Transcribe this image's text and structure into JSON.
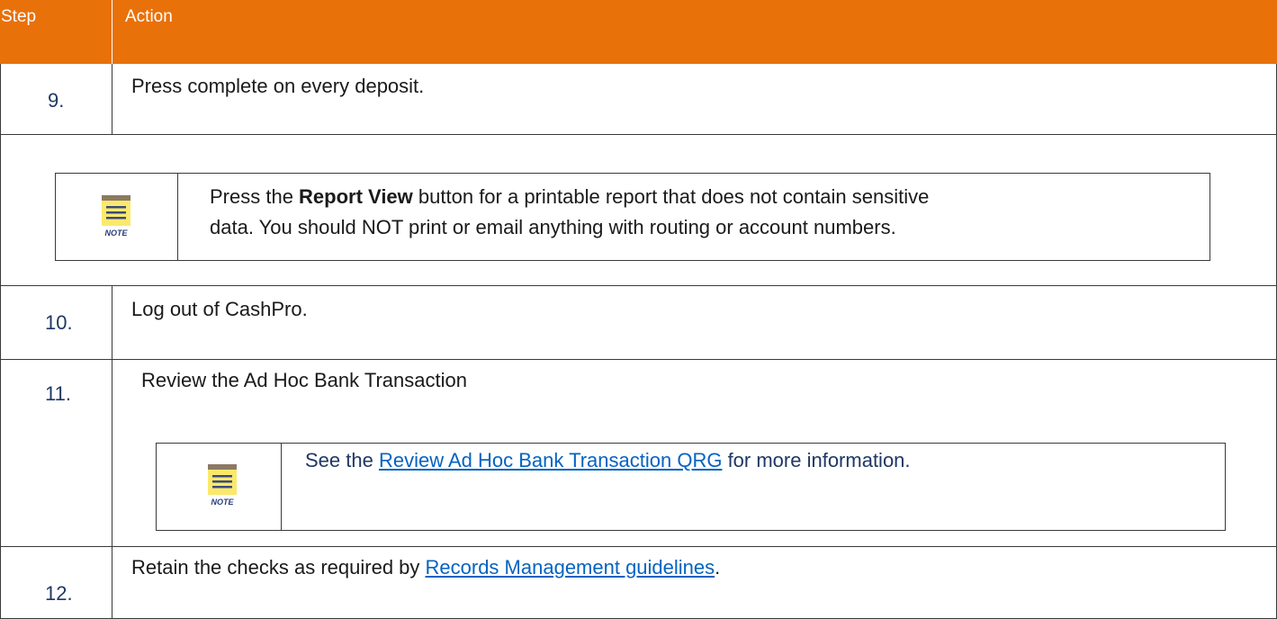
{
  "header": {
    "step_label": "Step",
    "action_label": "Action"
  },
  "rows": [
    {
      "step": "9.",
      "text": "Press complete on every deposit."
    },
    {
      "step": "10.",
      "text": "Log out of CashPro."
    },
    {
      "step": "11.",
      "text": "Review the Ad Hoc Bank Transaction"
    },
    {
      "step": "12.",
      "text_before": "Retain the checks as required by ",
      "link": "Records Management guidelines",
      "text_after": "."
    }
  ],
  "note1": {
    "icon_label": "NOTE",
    "line1_before": "Press the ",
    "line1_bold": "Report View",
    "line1_after": " button for a printable report that does not contain sensitive",
    "line2": "data.  You should NOT print or email anything with routing or account numbers."
  },
  "note2": {
    "icon_label": "NOTE",
    "text_before": "See the ",
    "link": "Review Ad Hoc Bank Transaction QRG",
    "text_after": " for more information."
  },
  "colors": {
    "header_bg": "#e8710a",
    "step_number": "#1f3864",
    "link": "#0563c1",
    "note_icon": "#fbe96b"
  },
  "icons": [
    "note-icon"
  ]
}
